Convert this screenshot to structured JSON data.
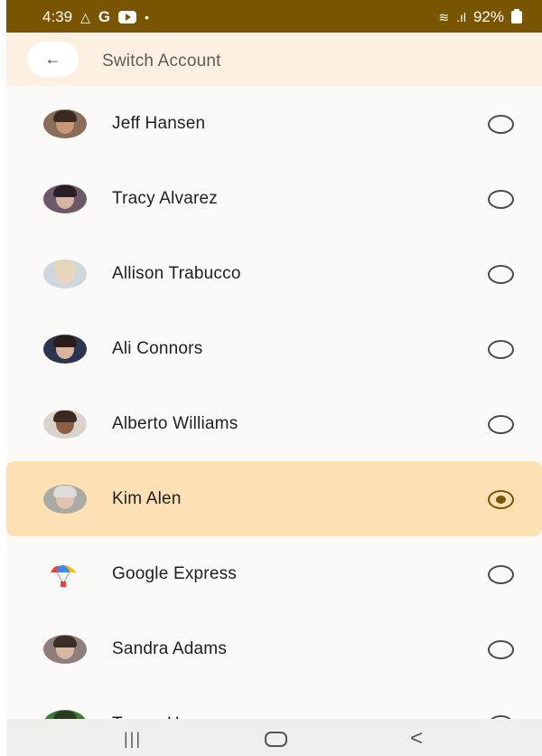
{
  "status_bar": {
    "time": "4:39",
    "battery": "92%",
    "icons": [
      "cloud-icon",
      "google-icon",
      "youtube-icon",
      "dot-icon",
      "wifi-icon",
      "signal-icon",
      "battery-charging-icon"
    ]
  },
  "header": {
    "title": "Switch Account",
    "back_icon": "←"
  },
  "accounts": [
    {
      "name": "Jeff Hansen",
      "selected": false
    },
    {
      "name": "Tracy Alvarez",
      "selected": false
    },
    {
      "name": "Allison Trabucco",
      "selected": false
    },
    {
      "name": "Ali Connors",
      "selected": false
    },
    {
      "name": "Alberto Williams",
      "selected": false
    },
    {
      "name": "Kim Alen",
      "selected": true
    },
    {
      "name": "Google Express",
      "selected": false
    },
    {
      "name": "Sandra Adams",
      "selected": false
    },
    {
      "name": "Trevor Hansen",
      "selected": false
    }
  ],
  "nav_bar": {
    "recents": "|||",
    "back": "<"
  },
  "colors": {
    "status_bar": "#7a5500",
    "header": "#fdf0e3",
    "selected_row": "#fde0b3",
    "accent": "#7a5500"
  }
}
